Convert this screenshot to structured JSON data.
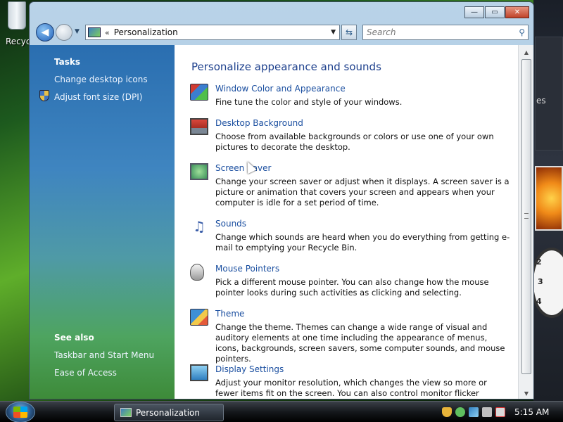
{
  "desktop": {
    "recycle_label": "Recyc",
    "gadget_text": "es"
  },
  "window": {
    "title_buttons": {
      "minimize": "—",
      "maximize": "▭",
      "close": "✕"
    },
    "nav": {
      "back_glyph": "◀",
      "address_chevron": "«",
      "address_text": "Personalization",
      "address_dropdown": "▼",
      "refresh_glyph": "⇆",
      "search_placeholder": "Search",
      "search_glyph": "⚲"
    },
    "tasks": {
      "heading": "Tasks",
      "items": [
        "Change desktop icons",
        "Adjust font size (DPI)"
      ],
      "see_also_heading": "See also",
      "see_also_items": [
        "Taskbar and Start Menu",
        "Ease of Access"
      ]
    },
    "content": {
      "heading": "Personalize appearance and sounds",
      "items": [
        {
          "title": "Window Color and Appearance",
          "desc": "Fine tune the color and style of your windows.",
          "icon": "window-color-icon"
        },
        {
          "title": "Desktop Background",
          "desc": "Choose from available backgrounds or colors or use one of your own pictures to decorate the desktop.",
          "icon": "desktop-background-icon"
        },
        {
          "title": "Screen Saver",
          "desc": "Change your screen saver or adjust when it displays. A screen saver is a picture or animation that covers your screen and appears when your computer is idle for a set period of time.",
          "icon": "screen-saver-icon"
        },
        {
          "title": "Sounds",
          "desc": "Change which sounds are heard when you do everything from getting e-mail to emptying your Recycle Bin.",
          "icon": "sounds-icon"
        },
        {
          "title": "Mouse Pointers",
          "desc": "Pick a different mouse pointer. You can also change how the mouse pointer looks during such activities as clicking and selecting.",
          "icon": "mouse-pointers-icon"
        },
        {
          "title": "Theme",
          "desc": "Change the theme. Themes can change a wide range of visual and auditory elements at one time including the appearance of menus, icons, backgrounds, screen savers, some computer sounds, and mouse pointers.",
          "icon": "theme-icon"
        },
        {
          "title": "Display Settings",
          "desc": "Adjust your monitor resolution, which changes the view so more or fewer items fit on the screen. You can also control monitor flicker (refresh rate).",
          "icon": "display-settings-icon"
        }
      ]
    },
    "scrollbar": {
      "up": "▲",
      "down": "▼"
    }
  },
  "taskbar": {
    "task_label": "Personalization",
    "time": "5:15 AM"
  },
  "colors": {
    "link": "#1b4fa0",
    "heading": "#1c3f8c",
    "task_pane_top": "#2a6eb0",
    "task_pane_bottom": "#3d8a38"
  }
}
